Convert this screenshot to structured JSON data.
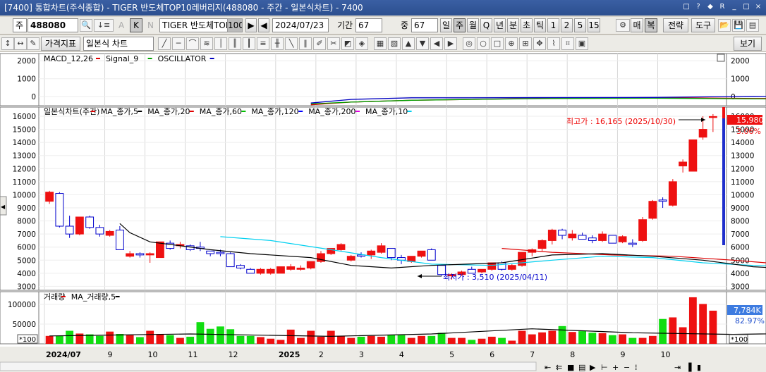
{
  "window": {
    "title": "[7400] 통합차트(주식종합) - TIGER 반도체TOP10레버리지(488080 - 주간 - 일본식차트) - 7400",
    "buttons": [
      "□",
      "?",
      "◆",
      "R",
      "_",
      "□",
      "×"
    ]
  },
  "toolbar1": {
    "market_select": "주",
    "code_input": "488080",
    "name_field": "TIGER 반도체TOP1",
    "name_suffix": "100",
    "date_field": "2024/07/23",
    "period_label": "기간",
    "period_value": "67",
    "count_label": "중",
    "count_value": "67",
    "period_buttons": [
      "일",
      "주",
      "월",
      "Q",
      "년",
      "분",
      "초",
      "틱",
      "1",
      "2",
      "5",
      "15"
    ],
    "active_period": "주",
    "right_buttons": [
      "매",
      "복",
      "전략",
      "도구"
    ],
    "extra_labels": [
      "A",
      "K",
      "N"
    ]
  },
  "toolbar2": {
    "indicator_button": "가격지표",
    "chart_type_select": "일본식 차트",
    "view_button": "보기"
  },
  "macd_pane": {
    "legend": [
      "MACD_12,26",
      "Signal_9",
      "OSCILLATOR"
    ],
    "legend_colors": [
      "#e00000",
      "#00a000",
      "#0000c0"
    ],
    "y_ticks": [
      "2000",
      "1000",
      "0"
    ]
  },
  "price_pane": {
    "legend": [
      "일본식차트(주간)",
      "MA_종가,5",
      "MA_종가,20",
      "MA_종가,60",
      "MA_종가,120",
      "MA_종가,200",
      "MA_종가,10"
    ],
    "legend_colors": [
      "#e00000",
      "#000000",
      "#e00000",
      "#00c000",
      "#0000ff",
      "#e000e0",
      "#00d0f0"
    ],
    "y_ticks": [
      "16000",
      "15000",
      "14000",
      "13000",
      "12000",
      "11000",
      "10000",
      "9000",
      "8000",
      "7000",
      "6000",
      "5000",
      "4000",
      "3000"
    ],
    "high_label": "최고가 : 16,165 (2025/10/30)",
    "low_label": "최저가 : 3,510 (2025/04/11)",
    "last_price": "15,980",
    "change_pct": "3.06%"
  },
  "volume_pane": {
    "legend": [
      "거래량",
      "MA_거래량,5"
    ],
    "legend_colors": [
      "#e00000",
      "#000000"
    ],
    "y_ticks": [
      "100000",
      "50000"
    ],
    "unit_label": "*100",
    "last_volume": "7,784K",
    "volume_pct": "82.97%"
  },
  "x_axis": {
    "labels": [
      "2024/07",
      "9",
      "10",
      "11",
      "12",
      "2025",
      "2",
      "3",
      "4",
      "5",
      "6",
      "7",
      "8",
      "9",
      "10"
    ]
  },
  "colors": {
    "up": "#ee1111",
    "down_fill": "#ffffff",
    "down_stroke": "#0000cc",
    "vol_up": "#ee1111",
    "vol_down": "#11dd11"
  },
  "chart_data": {
    "type": "candlestick",
    "ohlc": [
      [
        9500,
        10300,
        9300,
        10200
      ],
      [
        10100,
        10200,
        7500,
        7600
      ],
      [
        7600,
        8400,
        6700,
        7000
      ],
      [
        7000,
        8300,
        6900,
        8300
      ],
      [
        8300,
        8400,
        7400,
        7500
      ],
      [
        7500,
        7700,
        6800,
        7000
      ],
      [
        6900,
        7300,
        6800,
        7200
      ],
      [
        7300,
        7600,
        5800,
        5800
      ],
      [
        5300,
        5700,
        5200,
        5500
      ],
      [
        5500,
        5600,
        5200,
        5400
      ],
      [
        5400,
        5600,
        4800,
        5500
      ],
      [
        5200,
        6400,
        5200,
        6400
      ],
      [
        6300,
        6500,
        5800,
        5900
      ],
      [
        6100,
        6400,
        5900,
        6200
      ],
      [
        6100,
        6200,
        5700,
        5800
      ],
      [
        6000,
        6400,
        5700,
        5900
      ],
      [
        5700,
        5700,
        5300,
        5500
      ],
      [
        5600,
        5800,
        5300,
        5500
      ],
      [
        5500,
        5600,
        4500,
        4500
      ],
      [
        4600,
        4700,
        4300,
        4400
      ],
      [
        4300,
        4400,
        4000,
        4000
      ],
      [
        4000,
        4400,
        3900,
        4300
      ],
      [
        4000,
        4400,
        3900,
        4300
      ],
      [
        4000,
        4500,
        4000,
        4500
      ],
      [
        4300,
        4700,
        4200,
        4500
      ],
      [
        4300,
        4600,
        4200,
        4400
      ],
      [
        4400,
        4900,
        4300,
        4900
      ],
      [
        4900,
        5700,
        4800,
        5500
      ],
      [
        5500,
        5900,
        5400,
        5900
      ],
      [
        5800,
        6300,
        5700,
        6200
      ],
      [
        5000,
        5400,
        4900,
        5300
      ],
      [
        5400,
        5600,
        5200,
        5300
      ],
      [
        5400,
        5800,
        5100,
        5700
      ],
      [
        5600,
        6300,
        5500,
        6100
      ],
      [
        5900,
        5900,
        5000,
        5200
      ],
      [
        5200,
        5400,
        4700,
        5000
      ],
      [
        4900,
        5300,
        4800,
        5300
      ],
      [
        5300,
        5700,
        5200,
        5700
      ],
      [
        5800,
        5900,
        5000,
        5000
      ],
      [
        4600,
        4700,
        3800,
        3900
      ],
      [
        3800,
        4000,
        3510,
        3900
      ],
      [
        3900,
        4200,
        3800,
        4100
      ],
      [
        4300,
        4500,
        4000,
        4000
      ],
      [
        4100,
        4300,
        4000,
        4300
      ],
      [
        4300,
        4800,
        4200,
        4800
      ],
      [
        4800,
        4900,
        4200,
        4300
      ],
      [
        4300,
        4700,
        4200,
        4600
      ],
      [
        4600,
        5600,
        4500,
        5600
      ],
      [
        5600,
        5900,
        5300,
        5800
      ],
      [
        5900,
        6600,
        5700,
        6500
      ],
      [
        6500,
        7400,
        6200,
        7300
      ],
      [
        7300,
        7400,
        6600,
        6900
      ],
      [
        6700,
        7300,
        6500,
        7000
      ],
      [
        6900,
        7100,
        6600,
        6600
      ],
      [
        6700,
        6900,
        6300,
        6500
      ],
      [
        6500,
        7200,
        6400,
        7000
      ],
      [
        6900,
        6900,
        6300,
        6300
      ],
      [
        6400,
        6900,
        6300,
        6800
      ],
      [
        6300,
        6600,
        6000,
        6200
      ],
      [
        6500,
        8300,
        6400,
        8100
      ],
      [
        8200,
        9600,
        8100,
        9500
      ],
      [
        9600,
        9800,
        9000,
        9500
      ],
      [
        9200,
        11200,
        9100,
        11000
      ],
      [
        12200,
        12700,
        11700,
        12500
      ],
      [
        11800,
        14000,
        11800,
        14200
      ],
      [
        14400,
        16000,
        14200,
        15000
      ],
      [
        15900,
        16165,
        14800,
        15980
      ]
    ],
    "volume": [
      20000,
      20000,
      33000,
      26000,
      24000,
      20000,
      31000,
      25000,
      22000,
      17000,
      33000,
      24000,
      22000,
      15000,
      18000,
      55000,
      38000,
      44000,
      37000,
      20000,
      20000,
      17000,
      13000,
      10000,
      36000,
      15000,
      33000,
      18000,
      33000,
      20000,
      15000,
      18000,
      20000,
      18000,
      23000,
      22000,
      15000,
      20000,
      20000,
      28000,
      15000,
      15000,
      10000,
      13000,
      18000,
      15000,
      8000,
      33000,
      24000,
      29000,
      33000,
      45000,
      30000,
      32000,
      28000,
      27000,
      22000,
      24000,
      15000,
      15000,
      20000,
      63000,
      67000,
      42000,
      118000,
      101000,
      84000
    ],
    "ma_black": [
      [
        700,
        7800
      ],
      [
        800,
        7100
      ],
      [
        1000,
        6400
      ],
      [
        1600,
        5800
      ],
      [
        2000,
        5500
      ],
      [
        2600,
        5200
      ],
      [
        3000,
        4600
      ],
      [
        3400,
        4400
      ],
      [
        3800,
        4600
      ],
      [
        4500,
        4800
      ],
      [
        5000,
        5400
      ],
      [
        5500,
        5500
      ],
      [
        6000,
        5300
      ],
      [
        6500,
        5000
      ],
      [
        7000,
        4500
      ],
      [
        7500,
        4300
      ],
      [
        8000,
        4300
      ],
      [
        8400,
        4700
      ],
      [
        8700,
        5600
      ],
      [
        9000,
        6400
      ],
      [
        9500,
        6800
      ],
      [
        10000,
        6700
      ],
      [
        10500,
        6600
      ],
      [
        11000,
        6400
      ],
      [
        11500,
        6400
      ],
      [
        12000,
        6600
      ],
      [
        12500,
        8200
      ],
      [
        13000,
        10000
      ],
      [
        13400,
        12200
      ],
      [
        13800,
        13600
      ]
    ],
    "ma_cyan": [
      [
        1700,
        6800
      ],
      [
        2200,
        6500
      ],
      [
        2800,
        5800
      ],
      [
        3300,
        5200
      ],
      [
        3800,
        4700
      ],
      [
        4400,
        4600
      ],
      [
        5000,
        5000
      ],
      [
        5500,
        5300
      ],
      [
        6000,
        5200
      ],
      [
        6500,
        4800
      ],
      [
        7000,
        4600
      ],
      [
        7500,
        4500
      ],
      [
        8000,
        4600
      ],
      [
        8400,
        5000
      ],
      [
        8900,
        5600
      ],
      [
        9400,
        6200
      ],
      [
        10000,
        6500
      ],
      [
        10500,
        6500
      ],
      [
        11000,
        6400
      ],
      [
        11500,
        6600
      ],
      [
        12200,
        7600
      ],
      [
        12800,
        8800
      ],
      [
        13400,
        10000
      ],
      [
        13800,
        10700
      ]
    ],
    "ma_red": [
      [
        4500,
        5900
      ],
      [
        5000,
        5600
      ],
      [
        5600,
        5400
      ],
      [
        6200,
        5300
      ],
      [
        6800,
        5000
      ],
      [
        7300,
        4700
      ],
      [
        7800,
        4600
      ],
      [
        8300,
        4500
      ],
      [
        8800,
        4800
      ],
      [
        9400,
        5100
      ],
      [
        10000,
        5300
      ],
      [
        10800,
        5500
      ],
      [
        11500,
        5800
      ],
      [
        12100,
        6600
      ],
      [
        12800,
        7600
      ],
      [
        13400,
        8200
      ],
      [
        13800,
        8600
      ]
    ],
    "ma_green": [
      [
        12300,
        5600
      ],
      [
        12800,
        5700
      ],
      [
        13300,
        5900
      ],
      [
        13800,
        6100
      ]
    ],
    "vol_ma": [
      [
        0,
        20000
      ],
      [
        1400,
        25000
      ],
      [
        2800,
        19000
      ],
      [
        3800,
        25000
      ],
      [
        4800,
        38000
      ],
      [
        5800,
        28000
      ],
      [
        6800,
        24000
      ],
      [
        7800,
        28000
      ],
      [
        8800,
        26000
      ],
      [
        9800,
        20000
      ],
      [
        10800,
        30000
      ],
      [
        11400,
        32000
      ],
      [
        12200,
        22000
      ],
      [
        12600,
        28000
      ],
      [
        13200,
        50000
      ],
      [
        13800,
        70000
      ]
    ]
  }
}
